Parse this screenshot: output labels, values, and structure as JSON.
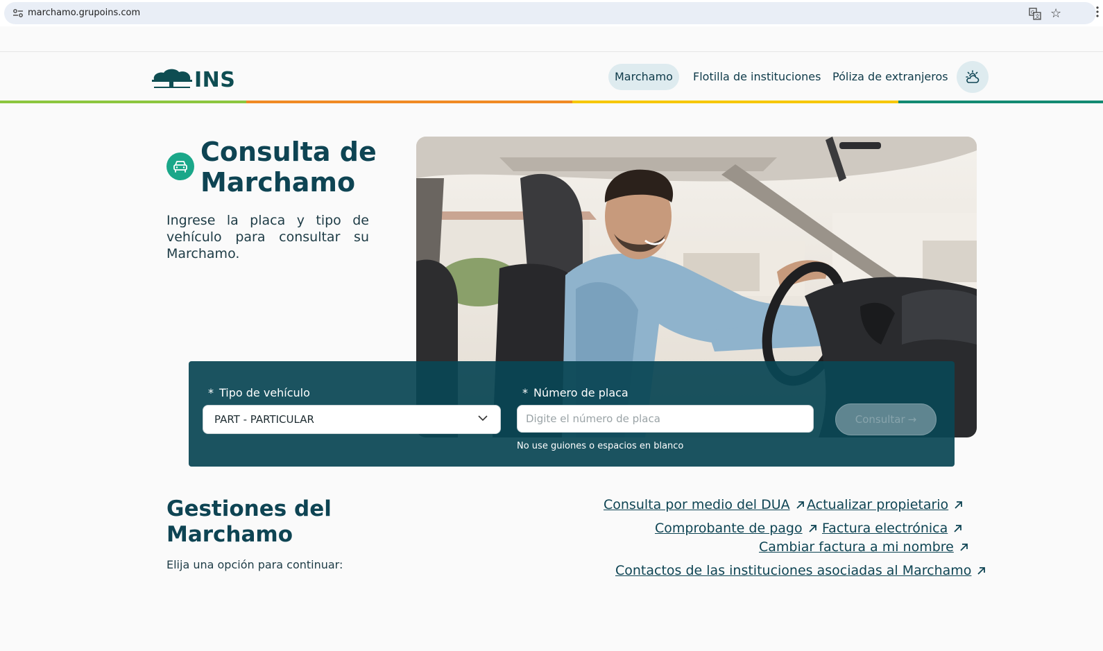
{
  "browser": {
    "url": "marchamo.grupoins.com"
  },
  "header": {
    "logo_text": "INS",
    "nav": [
      {
        "label": "Marchamo",
        "active": true
      },
      {
        "label": "Flotilla de instituciones",
        "active": false
      },
      {
        "label": "Póliza de extranjeros",
        "active": false
      }
    ],
    "accent_colors": [
      "#8cc63f",
      "#f08a24",
      "#f6c700",
      "#138a72"
    ]
  },
  "hero": {
    "title": "Consulta de Marchamo",
    "description": "Ingrese la placa y tipo de vehículo para consultar su Marchamo."
  },
  "search": {
    "vehicle_type_label": "Tipo de vehículo",
    "vehicle_type_value": "PART - PARTICULAR",
    "plate_label": "Número de placa",
    "plate_value": "",
    "plate_placeholder": "Digite el número de placa",
    "required_mark": "*",
    "help_text": "No use guiones o espacios en blanco",
    "submit_label": "Consultar"
  },
  "gestiones": {
    "title": "Gestiones del Marchamo",
    "subtitle": "Elija una opción para continuar:",
    "links": [
      "Consulta por medio del DUA",
      "Actualizar propietario",
      "Comprobante de pago",
      "Factura electrónica",
      "Cambiar factura a mi nombre",
      "Contactos de las instituciones asociadas al Marchamo"
    ]
  }
}
